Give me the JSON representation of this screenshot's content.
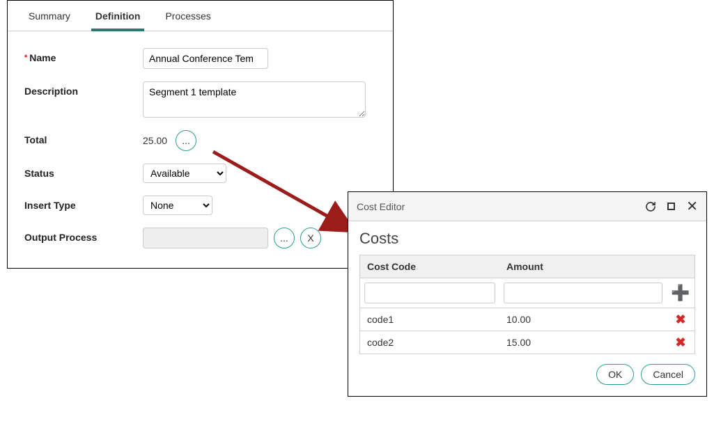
{
  "tabs": {
    "summary": "Summary",
    "definition": "Definition",
    "processes": "Processes"
  },
  "labels": {
    "name": "Name",
    "description": "Description",
    "total": "Total",
    "status": "Status",
    "insert_type": "Insert Type",
    "output_process": "Output Process"
  },
  "fields": {
    "name_value": "Annual Conference Tem",
    "description_value": "Segment 1 template",
    "total_value": "25.00",
    "status_value": "Available",
    "insert_type_value": "None",
    "output_process_value": ""
  },
  "buttons": {
    "ellipsis": "...",
    "clear": "X",
    "ok": "OK",
    "cancel": "Cancel"
  },
  "dialog": {
    "title": "Cost Editor",
    "heading": "Costs",
    "columns": {
      "code": "Cost Code",
      "amount": "Amount"
    },
    "rows": [
      {
        "code": "code1",
        "amount": "10.00"
      },
      {
        "code": "code2",
        "amount": "15.00"
      }
    ]
  }
}
